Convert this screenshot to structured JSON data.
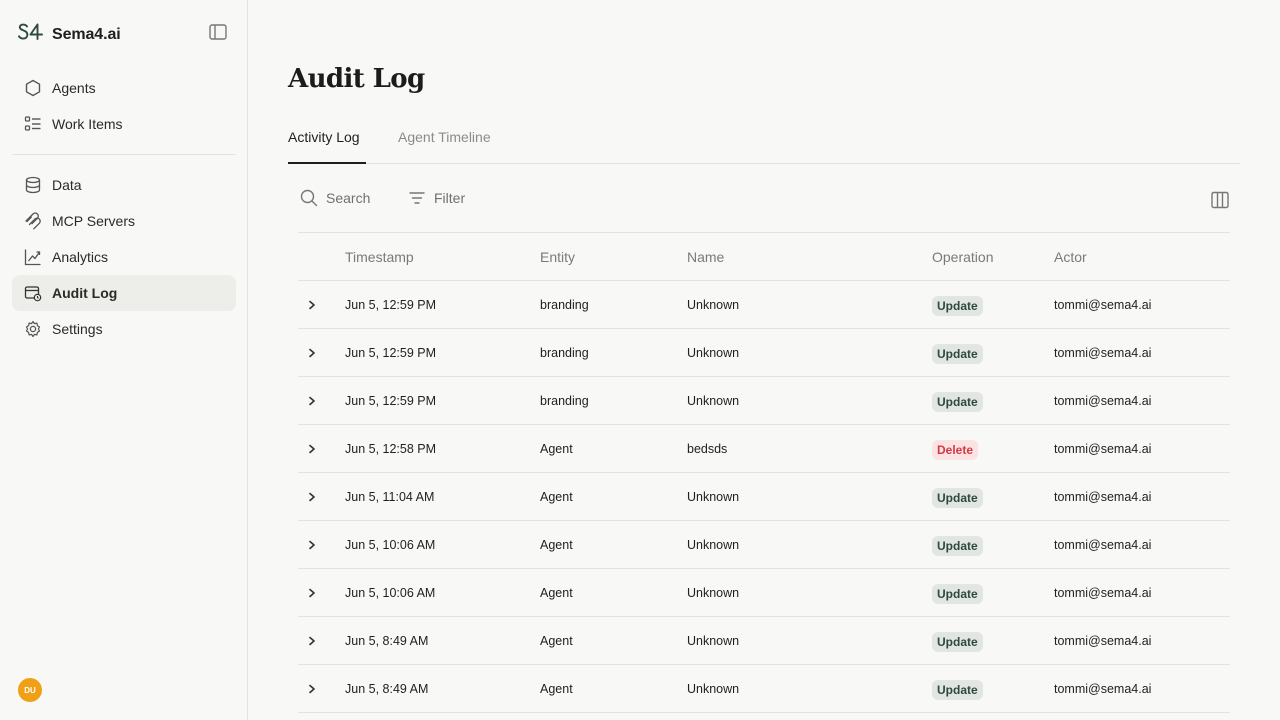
{
  "brand": {
    "name": "Sema4.ai"
  },
  "sidebar": {
    "items": [
      {
        "label": "Agents",
        "icon": "hexagon-icon"
      },
      {
        "label": "Work Items",
        "icon": "list-icon"
      },
      {
        "label": "Data",
        "icon": "database-icon"
      },
      {
        "label": "MCP Servers",
        "icon": "mcp-icon"
      },
      {
        "label": "Analytics",
        "icon": "chart-icon"
      },
      {
        "label": "Audit Log",
        "icon": "audit-icon",
        "active": true
      },
      {
        "label": "Settings",
        "icon": "gear-icon"
      }
    ],
    "user_initials": "DU"
  },
  "main": {
    "title": "Audit Log",
    "tabs": [
      {
        "label": "Activity Log",
        "active": true
      },
      {
        "label": "Agent Timeline",
        "active": false
      }
    ],
    "toolbar": {
      "search_label": "Search",
      "filter_label": "Filter"
    },
    "table": {
      "columns": [
        "Timestamp",
        "Entity",
        "Name",
        "Operation",
        "Actor"
      ],
      "rows": [
        {
          "timestamp": "Jun 5, 12:59 PM",
          "entity": "branding",
          "name": "Unknown",
          "operation": "Update",
          "actor": "tommi@sema4.ai"
        },
        {
          "timestamp": "Jun 5, 12:59 PM",
          "entity": "branding",
          "name": "Unknown",
          "operation": "Update",
          "actor": "tommi@sema4.ai"
        },
        {
          "timestamp": "Jun 5, 12:59 PM",
          "entity": "branding",
          "name": "Unknown",
          "operation": "Update",
          "actor": "tommi@sema4.ai"
        },
        {
          "timestamp": "Jun 5, 12:58 PM",
          "entity": "Agent",
          "name": "bedsds",
          "operation": "Delete",
          "actor": "tommi@sema4.ai"
        },
        {
          "timestamp": "Jun 5, 11:04 AM",
          "entity": "Agent",
          "name": "Unknown",
          "operation": "Update",
          "actor": "tommi@sema4.ai"
        },
        {
          "timestamp": "Jun 5, 10:06 AM",
          "entity": "Agent",
          "name": "Unknown",
          "operation": "Update",
          "actor": "tommi@sema4.ai"
        },
        {
          "timestamp": "Jun 5, 10:06 AM",
          "entity": "Agent",
          "name": "Unknown",
          "operation": "Update",
          "actor": "tommi@sema4.ai"
        },
        {
          "timestamp": "Jun 5, 8:49 AM",
          "entity": "Agent",
          "name": "Unknown",
          "operation": "Update",
          "actor": "tommi@sema4.ai"
        },
        {
          "timestamp": "Jun 5, 8:49 AM",
          "entity": "Agent",
          "name": "Unknown",
          "operation": "Update",
          "actor": "tommi@sema4.ai"
        }
      ]
    }
  },
  "colors": {
    "accent": "#1f1f1f",
    "update_badge": "#e2e6e3",
    "delete_badge": "#fbe3e4",
    "delete_text": "#d23a46",
    "avatar": "#f0a016"
  }
}
